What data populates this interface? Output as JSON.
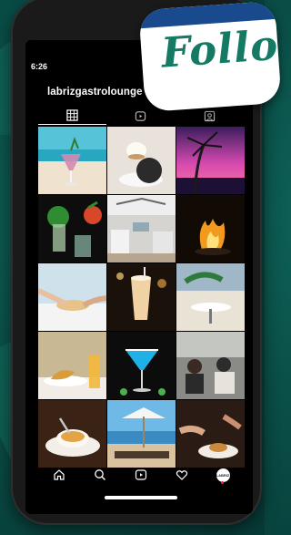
{
  "profile": {
    "status_time": "6:26",
    "username": "labrizgastrolounge"
  },
  "tabs": [
    {
      "name": "posts-grid",
      "icon": "grid-icon",
      "active": true
    },
    {
      "name": "reels",
      "icon": "reels-icon",
      "active": false
    },
    {
      "name": "tagged",
      "icon": "tagged-person-icon",
      "active": false
    }
  ],
  "posts": [
    {
      "name": "cocktail-on-beach-post"
    },
    {
      "name": "dessert-coconut-post"
    },
    {
      "name": "palm-sunset-post"
    },
    {
      "name": "mint-cocktails-post"
    },
    {
      "name": "restaurant-interior-post"
    },
    {
      "name": "flambe-dish-post"
    },
    {
      "name": "table-dining-post"
    },
    {
      "name": "iced-coffee-drink-post"
    },
    {
      "name": "terrace-tables-post"
    },
    {
      "name": "tacos-beer-post"
    },
    {
      "name": "blue-margarita-post"
    },
    {
      "name": "guests-dining-post"
    },
    {
      "name": "soup-bowl-post"
    },
    {
      "name": "beach-umbrella-post"
    },
    {
      "name": "hands-dining-post"
    }
  ],
  "bottom_nav": {
    "items": [
      "home-icon",
      "search-icon",
      "reels-icon",
      "heart-icon",
      "profile-avatar"
    ],
    "avatar_text": "LABRIZ"
  },
  "overlay": {
    "follow_text": "Follo"
  },
  "colors": {
    "background": "#0a4f48",
    "follow_text": "#157a64",
    "follow_band": "#1a4a8e"
  }
}
